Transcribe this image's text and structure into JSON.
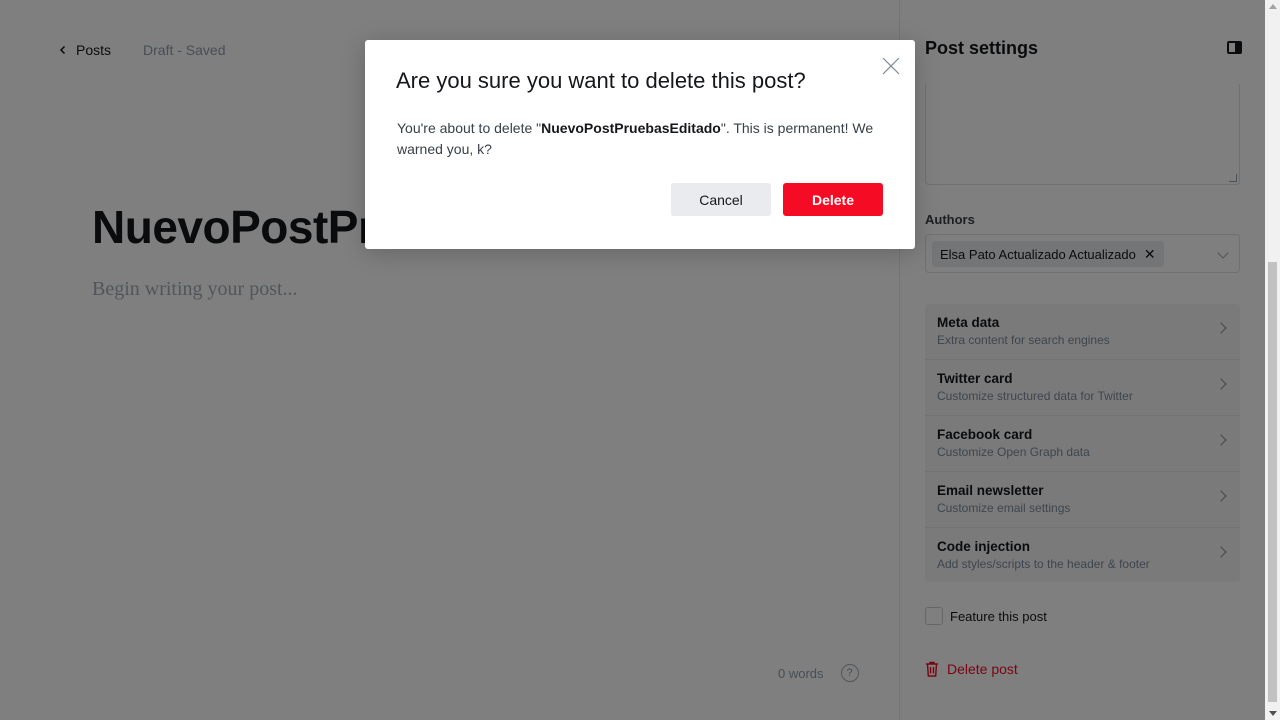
{
  "editor": {
    "back_label": "Posts",
    "status": "Draft - Saved",
    "title": "NuevoPostPruebasEditado",
    "body_placeholder": "Begin writing your post...",
    "word_count": "0 words",
    "help_glyph": "?"
  },
  "panel": {
    "title": "Post settings",
    "authors_label": "Authors",
    "author_token": "Elsa Pato Actualizado Actualizado",
    "author_remove_glyph": "✕",
    "items": [
      {
        "title": "Meta data",
        "sub": "Extra content for search engines"
      },
      {
        "title": "Twitter card",
        "sub": "Customize structured data for Twitter"
      },
      {
        "title": "Facebook card",
        "sub": "Customize Open Graph data"
      },
      {
        "title": "Email newsletter",
        "sub": "Customize email settings"
      },
      {
        "title": "Code injection",
        "sub": "Add styles/scripts to the header & footer"
      }
    ],
    "feature_label": "Feature this post",
    "delete_label": "Delete post"
  },
  "modal": {
    "title": "Are you sure you want to delete this post?",
    "text_before": "You're about to delete \"",
    "post_name": "NuevoPostPruebasEditado",
    "text_after": "\". This is permanent! We warned you, k?",
    "cancel_label": "Cancel",
    "delete_label": "Delete"
  },
  "colors": {
    "danger": "#f50b23",
    "overlay": "rgba(0,0,0,0.5)"
  },
  "icons": [
    "chevron-left-icon",
    "help-icon",
    "sidebar-toggle-icon",
    "close-icon",
    "chevron-down-icon",
    "chevron-right-icon",
    "trash-icon"
  ]
}
